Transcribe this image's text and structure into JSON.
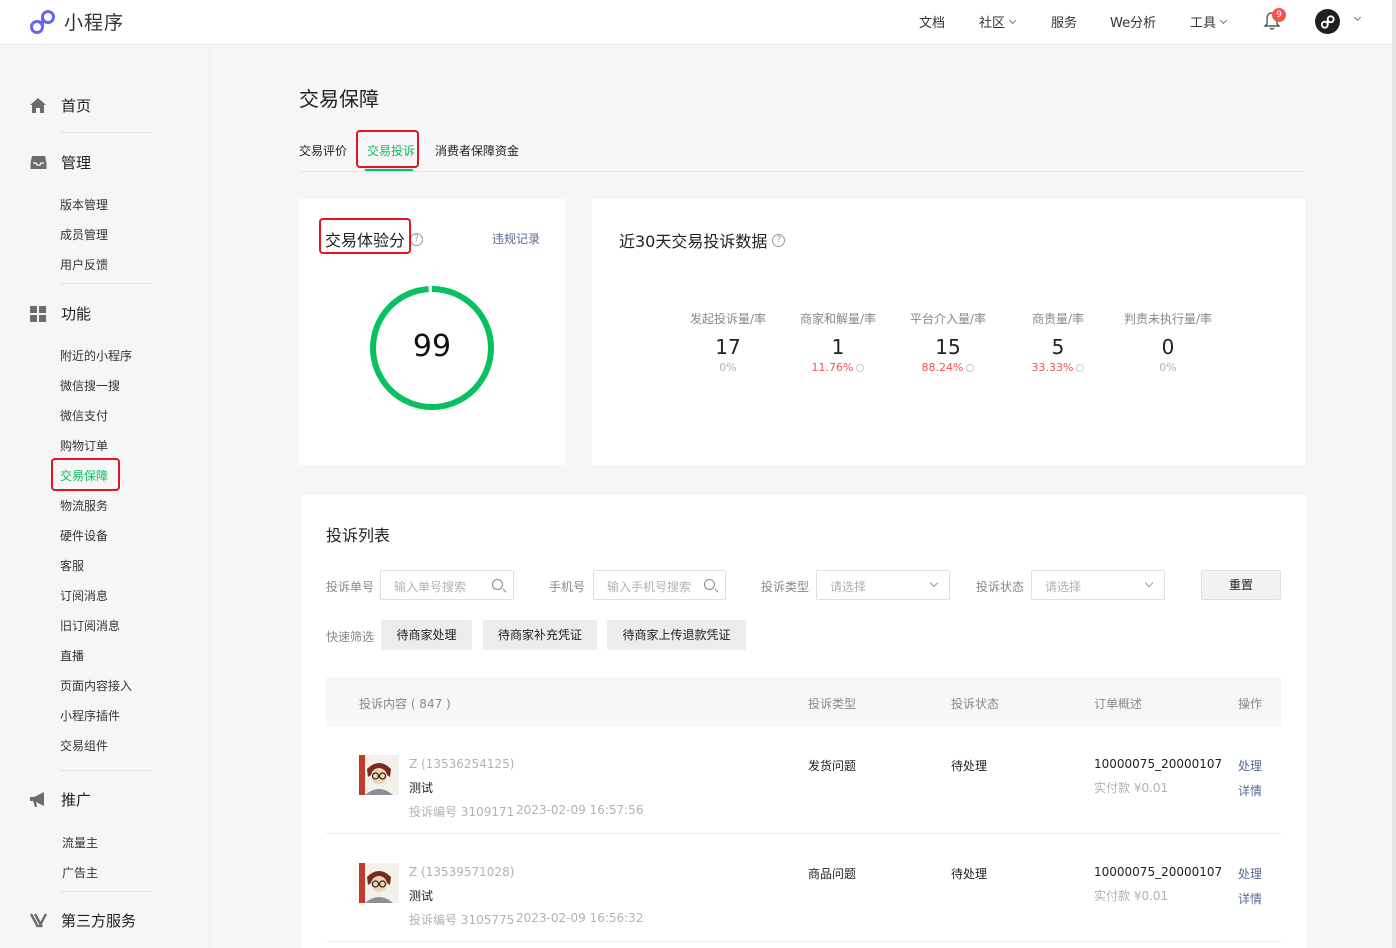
{
  "app": {
    "logo_text": "小程序"
  },
  "topnav": [
    {
      "label": "文档",
      "caret": false
    },
    {
      "label": "社区",
      "caret": true
    },
    {
      "label": "服务",
      "caret": false
    },
    {
      "label": "We分析",
      "caret": false
    },
    {
      "label": "工具",
      "caret": true
    }
  ],
  "notifications": {
    "count": "9"
  },
  "sidebar": {
    "home": "首页",
    "manage": {
      "title": "管理",
      "items": [
        "版本管理",
        "成员管理",
        "用户反馈"
      ]
    },
    "feature": {
      "title": "功能",
      "items": [
        "附近的小程序",
        "微信搜一搜",
        "微信支付",
        "购物订单",
        "交易保障",
        "物流服务",
        "硬件设备",
        "客服",
        "订阅消息",
        "旧订阅消息",
        "直播",
        "页面内容接入",
        "小程序插件",
        "交易组件"
      ],
      "active_index": 4
    },
    "promo": {
      "title": "推广",
      "items": [
        "流量主",
        "广告主"
      ]
    },
    "third": {
      "title": "第三方服务"
    }
  },
  "page": {
    "title": "交易保障",
    "tabs": [
      "交易评价",
      "交易投诉",
      "消费者保障资金"
    ],
    "active_tab": 1
  },
  "score_card": {
    "title": "交易体验分",
    "link": "违规记录",
    "score": "99",
    "score_fraction": 0.99
  },
  "complaint_stats": {
    "title": "近30天交易投诉数据",
    "items": [
      {
        "label": "发起投诉量/率",
        "value": "17",
        "rate": "0%",
        "red": false,
        "help": false
      },
      {
        "label": "商家和解量/率",
        "value": "1",
        "rate": "11.76%",
        "red": true,
        "help": true
      },
      {
        "label": "平台介入量/率",
        "value": "15",
        "rate": "88.24%",
        "red": true,
        "help": true
      },
      {
        "label": "商责量/率",
        "value": "5",
        "rate": "33.33%",
        "red": true,
        "help": true
      },
      {
        "label": "判责未执行量/率",
        "value": "0",
        "rate": "0%",
        "red": false,
        "help": false
      }
    ]
  },
  "list": {
    "title": "投诉列表",
    "filters": {
      "order_no_label": "投诉单号",
      "order_no_placeholder": "输入单号搜索",
      "phone_label": "手机号",
      "phone_placeholder": "输入手机号搜索",
      "type_label": "投诉类型",
      "type_placeholder": "请选择",
      "status_label": "投诉状态",
      "status_placeholder": "请选择",
      "reset": "重置",
      "quick_label": "快速筛选",
      "quick": [
        "待商家处理",
        "待商家补充凭证",
        "待商家上传退款凭证"
      ]
    },
    "columns": [
      "投诉内容 ( 847 )",
      "投诉类型",
      "投诉状态",
      "订单概述",
      "操作"
    ],
    "rows": [
      {
        "user": "Z (13536254125)",
        "content": "测试",
        "meta_no": "投诉编号 3109171",
        "meta_time": "2023-02-09 16:57:56",
        "type": "发货问题",
        "status": "待处理",
        "order": "10000075_20000107",
        "paid": "实付款 ¥0.01",
        "action1": "处理",
        "action2": "详情"
      },
      {
        "user": "Z (13539571028)",
        "content": "测试",
        "meta_no": "投诉编号 3105775",
        "meta_time": "2023-02-09 16:56:32",
        "type": "商品问题",
        "status": "待处理",
        "order": "10000075_20000107",
        "paid": "实付款 ¥0.01",
        "action1": "处理",
        "action2": "详情"
      }
    ]
  },
  "colors": {
    "green": "#07c160",
    "red": "#fa5151",
    "link": "#576b95",
    "highlight": "#e0151f"
  }
}
